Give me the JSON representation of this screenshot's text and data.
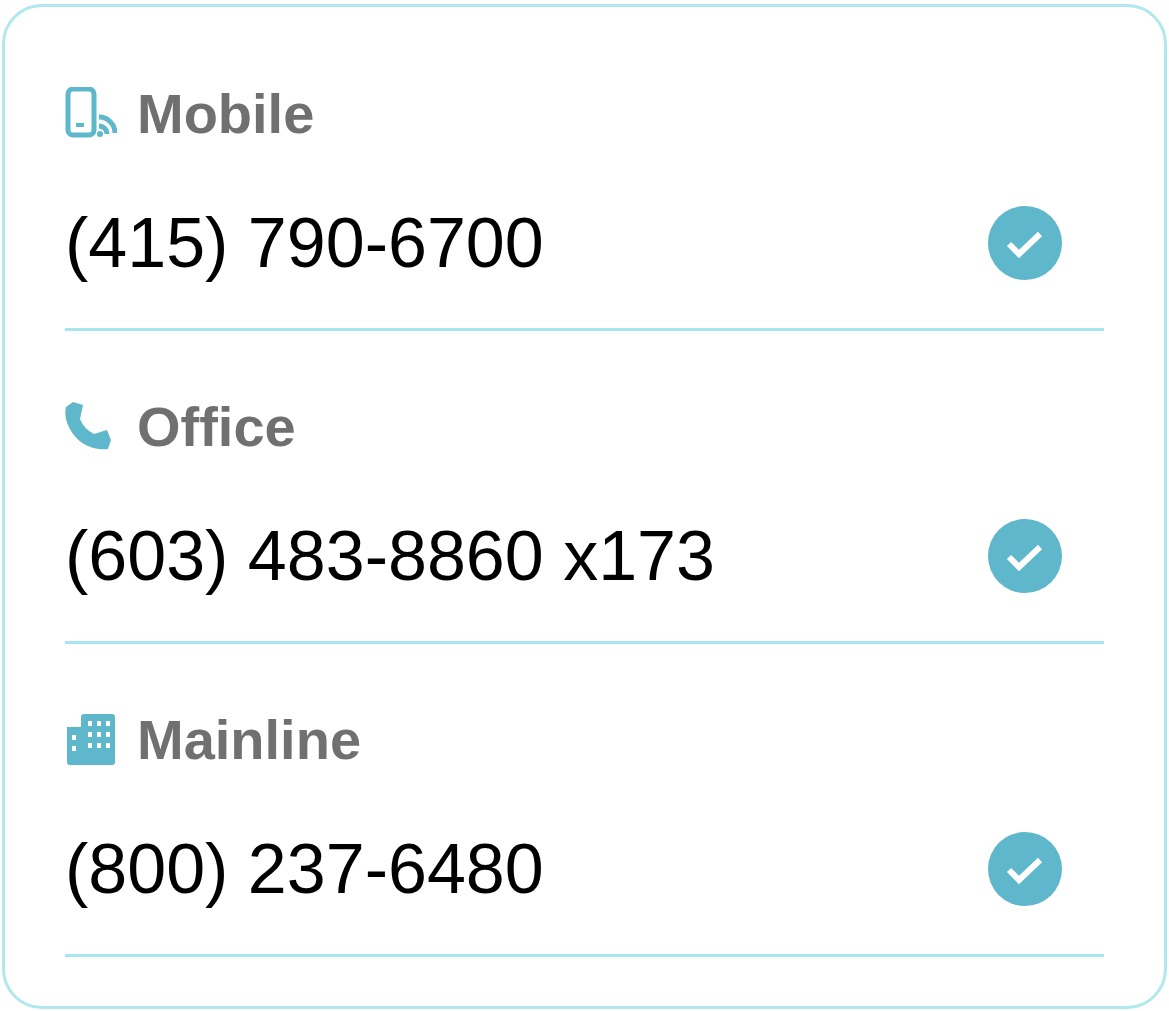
{
  "phones": [
    {
      "kind": "mobile",
      "label": "Mobile",
      "number": "(415) 790-6700",
      "verified": true
    },
    {
      "kind": "office",
      "label": "Office",
      "number": "(603) 483-8860 x173",
      "verified": true
    },
    {
      "kind": "mainline",
      "label": "Mainline",
      "number": "(800) 237-6480",
      "verified": true
    }
  ]
}
